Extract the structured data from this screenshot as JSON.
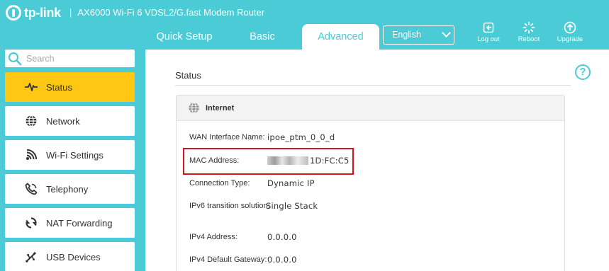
{
  "header": {
    "brand": "tp-link",
    "separator": "|",
    "product": "AX6000 Wi-Fi 6 VDSL2/G.fast Modem Router",
    "tabs": [
      {
        "label": "Quick Setup"
      },
      {
        "label": "Basic"
      },
      {
        "label": "Advanced"
      }
    ],
    "language": "English",
    "buttons": {
      "logout": "Log out",
      "reboot": "Reboot",
      "upgrade": "Upgrade"
    }
  },
  "sidebar": {
    "search_placeholder": "Search",
    "items": [
      {
        "label": "Status",
        "icon": "status-pulse-icon"
      },
      {
        "label": "Network",
        "icon": "globe-icon"
      },
      {
        "label": "Wi-Fi Settings",
        "icon": "wifi-icon"
      },
      {
        "label": "Telephony",
        "icon": "phone-icon"
      },
      {
        "label": "NAT Forwarding",
        "icon": "nat-icon"
      },
      {
        "label": "USB Devices",
        "icon": "usb-icon"
      }
    ]
  },
  "main": {
    "title": "Status",
    "help": "?",
    "card": {
      "title": "Internet",
      "rows": [
        {
          "label": "WAN Interface Name:",
          "value": "ipoe_ptm_0_0_d"
        },
        {
          "label": "MAC Address:",
          "value": "1D:FC:C5"
        },
        {
          "label": "Connection Type:",
          "value": "Dynamic IP"
        },
        {
          "label": "IPv6 transition solution:",
          "value": "Single Stack"
        },
        {
          "label": "IPv4 Address:",
          "value": "0.0.0.0"
        },
        {
          "label": "IPv4 Default Gateway:",
          "value": "0.0.0.0"
        }
      ]
    }
  },
  "colors": {
    "accent": "#4acbd6",
    "active_item": "#fdc713",
    "highlight": "#d5141c"
  }
}
